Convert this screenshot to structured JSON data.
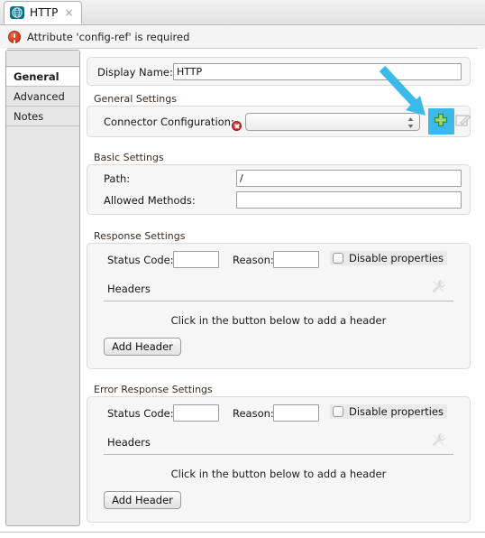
{
  "tab": {
    "label": "HTTP",
    "close_label": "×",
    "icon": "globe-icon",
    "icon_color": "#0d6e82"
  },
  "error_banner": {
    "icon": "error-exclamation-icon",
    "message": "Attribute 'config-ref' is required",
    "color": "#e03b1c"
  },
  "sidebar": {
    "items": [
      {
        "label": "General",
        "selected": true
      },
      {
        "label": "Advanced",
        "selected": false
      },
      {
        "label": "Notes",
        "selected": false
      }
    ]
  },
  "display_name": {
    "label": "Display Name:",
    "value": "HTTP",
    "placeholder": ""
  },
  "general_settings": {
    "title": "General Settings",
    "connector_label": "Connector Configuration:",
    "required_marker": "required-error-icon",
    "connector_value": "",
    "connector_placeholder": "",
    "add_button": "add-green-plus-button",
    "edit_button": "edit-pencil-button"
  },
  "basic_settings": {
    "title": "Basic Settings",
    "fields": [
      {
        "label": "Path:",
        "value": "/"
      },
      {
        "label": "Allowed Methods:",
        "value": ""
      }
    ]
  },
  "response_settings": {
    "title": "Response Settings",
    "status_code_label": "Status Code:",
    "status_code_value": "",
    "reason_label": "Reason:",
    "reason_value": "",
    "disable_label": "Disable properties",
    "disable_checked": false,
    "headers_label": "Headers",
    "hint": "Click in the button below to add a header",
    "add_header_label": "Add Header",
    "tool_icon": "wrench-disabled-icon"
  },
  "error_response_settings": {
    "title": "Error Response Settings",
    "status_code_label": "Status Code:",
    "status_code_value": "",
    "reason_label": "Reason:",
    "reason_value": "",
    "disable_label": "Disable properties",
    "disable_checked": false,
    "headers_label": "Headers",
    "hint": "Click in the button below to add a header",
    "add_header_label": "Add Header",
    "tool_icon": "wrench-disabled-icon"
  },
  "annotation": {
    "arrow_color": "#3bb9e8",
    "highlight_color": "#3bb9e8"
  }
}
